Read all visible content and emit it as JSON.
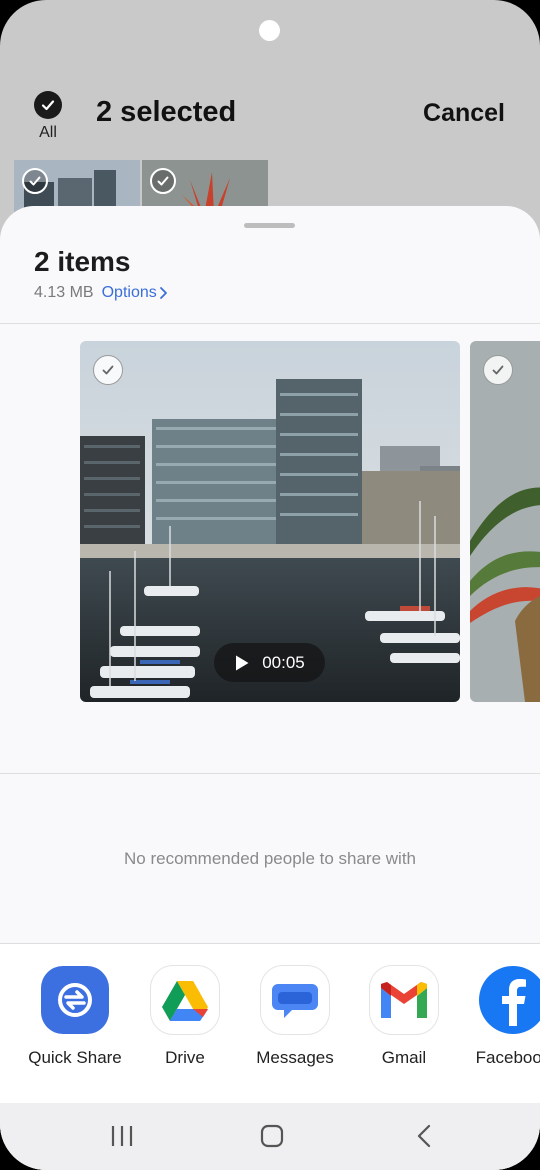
{
  "header": {
    "select_all_label": "All",
    "selected_title": "2 selected",
    "cancel_label": "Cancel"
  },
  "sheet": {
    "title": "2 items",
    "size": "4.13 MB",
    "options_label": "Options",
    "video_duration": "00:05",
    "no_recommend_text": "No recommended people to share with"
  },
  "apps": [
    {
      "label": "Quick Share",
      "icon": "quick-share-icon"
    },
    {
      "label": "Drive",
      "icon": "drive-icon"
    },
    {
      "label": "Messages",
      "icon": "messages-icon"
    },
    {
      "label": "Gmail",
      "icon": "gmail-icon"
    },
    {
      "label": "Facebook",
      "icon": "facebook-icon"
    }
  ],
  "nav": {
    "recents_icon": "recents-icon",
    "home_icon": "home-icon",
    "back_icon": "back-icon"
  },
  "colors": {
    "accent": "#3a6fd8",
    "quick_share": "#3c70e0",
    "facebook": "#1877f2"
  }
}
